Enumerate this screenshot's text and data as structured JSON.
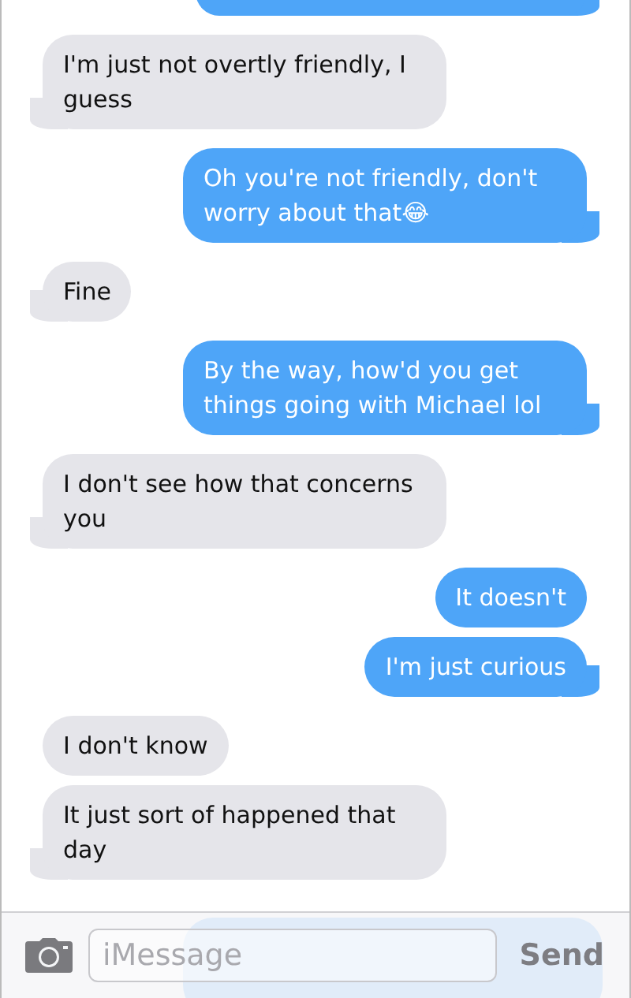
{
  "messages": [
    {
      "kind": "outgoing"
    },
    {
      "kind": "incoming",
      "text": "I'm just not overtly friendly, I guess"
    },
    {
      "kind": "outgoing",
      "text": "Oh you're not friendly, don't worry about that😂"
    },
    {
      "kind": "incoming",
      "text": "Fine"
    },
    {
      "kind": "outgoing",
      "text": "By the way, how'd you get things going with Michael lol"
    },
    {
      "kind": "incoming",
      "text": "I don't see how that concerns you"
    },
    {
      "kind": "outgoing",
      "text": "It doesn't"
    },
    {
      "kind": "outgoing",
      "text": "I'm just curious"
    },
    {
      "kind": "incoming",
      "text": "I don't know"
    },
    {
      "kind": "incoming",
      "text": "It just sort of happened that day"
    },
    {
      "kind": "outgoing"
    }
  ],
  "input_bar": {
    "placeholder": "iMessage",
    "send": "Send"
  }
}
